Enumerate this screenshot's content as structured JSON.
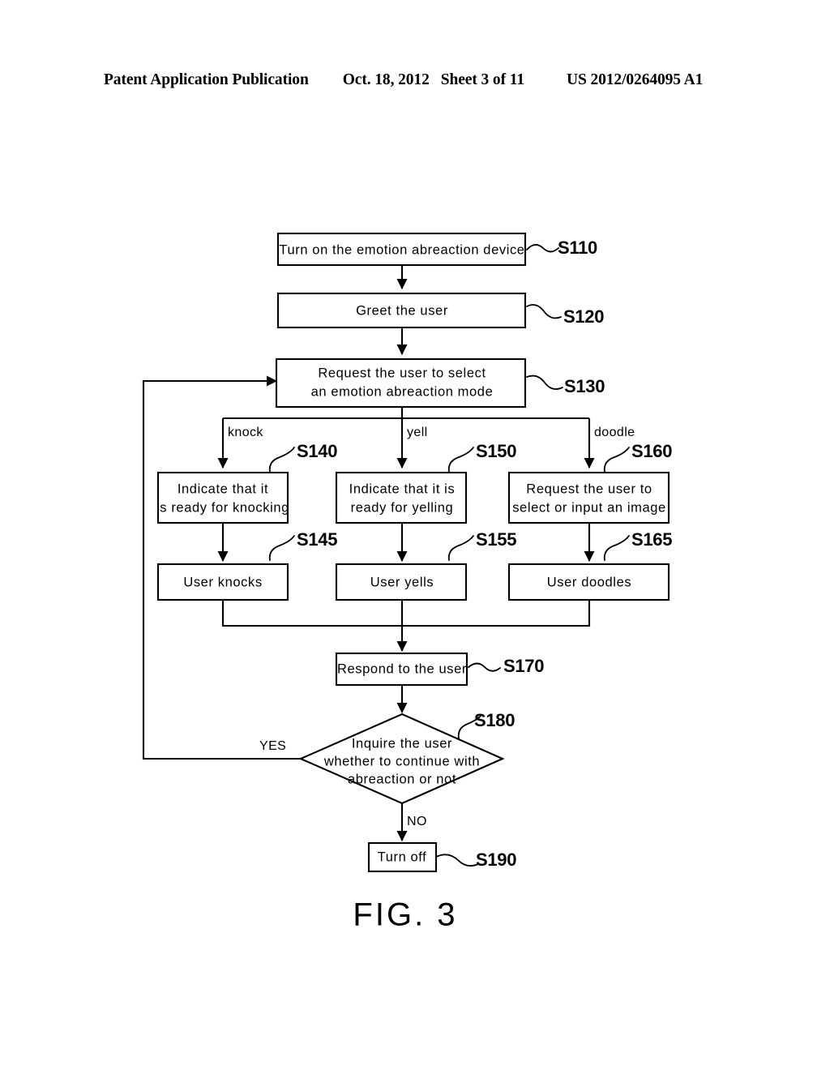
{
  "header": {
    "publication": "Patent Application Publication",
    "date": "Oct. 18, 2012",
    "sheet": "Sheet 3 of 11",
    "patent_number": "US 2012/0264095 A1"
  },
  "figure": {
    "caption": "FIG. 3"
  },
  "chart_data": {
    "type": "diagram",
    "title": "FIG. 3",
    "diagram_kind": "flowchart",
    "nodes": [
      {
        "id": "S110",
        "ref": "S110",
        "shape": "process",
        "lines": [
          "Turn on the emotion abreaction device"
        ]
      },
      {
        "id": "S120",
        "ref": "S120",
        "shape": "process",
        "lines": [
          "Greet the user"
        ]
      },
      {
        "id": "S130",
        "ref": "S130",
        "shape": "process",
        "lines": [
          "Request the user to select",
          "an emotion abreaction mode"
        ]
      },
      {
        "id": "S140",
        "ref": "S140",
        "shape": "process",
        "lines": [
          "Indicate that it",
          "is ready for knocking"
        ]
      },
      {
        "id": "S150",
        "ref": "S150",
        "shape": "process",
        "lines": [
          "Indicate that it is",
          "ready for yelling"
        ]
      },
      {
        "id": "S160",
        "ref": "S160",
        "shape": "process",
        "lines": [
          "Request the user to",
          "select or input an image"
        ]
      },
      {
        "id": "S145",
        "ref": "S145",
        "shape": "process",
        "lines": [
          "User knocks"
        ]
      },
      {
        "id": "S155",
        "ref": "S155",
        "shape": "process",
        "lines": [
          "User yells"
        ]
      },
      {
        "id": "S165",
        "ref": "S165",
        "shape": "process",
        "lines": [
          "User doodles"
        ]
      },
      {
        "id": "S170",
        "ref": "S170",
        "shape": "process",
        "lines": [
          "Respond to the user"
        ]
      },
      {
        "id": "S180",
        "ref": "S180",
        "shape": "decision",
        "lines": [
          "Inquire the user",
          "whether to continue with",
          "abreaction or not"
        ]
      },
      {
        "id": "S190",
        "ref": "S190",
        "shape": "process",
        "lines": [
          "Turn off"
        ]
      }
    ],
    "edge_labels": [
      {
        "id": "knock",
        "text": "knock"
      },
      {
        "id": "yell",
        "text": "yell"
      },
      {
        "id": "doodle",
        "text": "doodle"
      },
      {
        "id": "yes",
        "text": "YES"
      },
      {
        "id": "no",
        "text": "NO"
      }
    ],
    "edges": [
      {
        "from": "S110",
        "to": "S120"
      },
      {
        "from": "S120",
        "to": "S130"
      },
      {
        "from": "S130",
        "to": "S140",
        "label": "knock"
      },
      {
        "from": "S130",
        "to": "S150",
        "label": "yell"
      },
      {
        "from": "S130",
        "to": "S160",
        "label": "doodle"
      },
      {
        "from": "S140",
        "to": "S145"
      },
      {
        "from": "S150",
        "to": "S155"
      },
      {
        "from": "S160",
        "to": "S165"
      },
      {
        "from": "S145",
        "to": "S170"
      },
      {
        "from": "S155",
        "to": "S170"
      },
      {
        "from": "S165",
        "to": "S170"
      },
      {
        "from": "S170",
        "to": "S180"
      },
      {
        "from": "S180",
        "to": "S130",
        "label": "YES"
      },
      {
        "from": "S180",
        "to": "S190",
        "label": "NO"
      }
    ]
  },
  "nodes": {
    "S110": {
      "ref": "S110",
      "line1": "Turn on the emotion abreaction device"
    },
    "S120": {
      "ref": "S120",
      "line1": "Greet the user"
    },
    "S130": {
      "ref": "S130",
      "line1": "Request the user to select",
      "line2": "an emotion abreaction mode"
    },
    "S140": {
      "ref": "S140",
      "line1": "Indicate that it",
      "line2": "is ready for knocking"
    },
    "S150": {
      "ref": "S150",
      "line1": "Indicate that it is",
      "line2": "ready for yelling"
    },
    "S160": {
      "ref": "S160",
      "line1": "Request the user to",
      "line2": "select or input an image"
    },
    "S145": {
      "ref": "S145",
      "line1": "User knocks"
    },
    "S155": {
      "ref": "S155",
      "line1": "User yells"
    },
    "S165": {
      "ref": "S165",
      "line1": "User doodles"
    },
    "S170": {
      "ref": "S170",
      "line1": "Respond to the user"
    },
    "S180": {
      "ref": "S180",
      "line1": "Inquire the user",
      "line2": "whether to continue with",
      "line3": "abreaction or not"
    },
    "S190": {
      "ref": "S190",
      "line1": "Turn off"
    }
  },
  "labels": {
    "knock": "knock",
    "yell": "yell",
    "doodle": "doodle",
    "yes": "YES",
    "no": "NO"
  }
}
